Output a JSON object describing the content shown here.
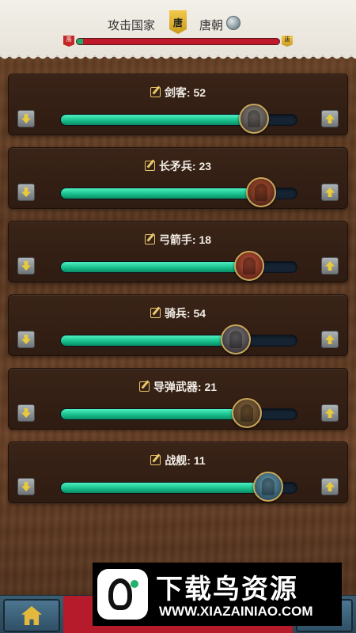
{
  "header": {
    "attack_label": "攻击国家",
    "banner_char": "唐",
    "nation_name": "唐朝",
    "left_flag_char": "燕",
    "right_flag_char": "唐",
    "war_progress": {
      "green": 0.03,
      "red": 0.97
    },
    "colors": {
      "ally": "#1fae6a",
      "enemy": "#c0192b",
      "gold": "#e3b93d"
    }
  },
  "units": [
    {
      "label": "剑客: 52",
      "fill": 0.82,
      "thumb_icon": "swordsman-icon"
    },
    {
      "label": "长矛兵: 23",
      "fill": 0.85,
      "thumb_icon": "spearman-icon"
    },
    {
      "label": "弓箭手: 18",
      "fill": 0.8,
      "thumb_icon": "archer-icon"
    },
    {
      "label": "骑兵: 54",
      "fill": 0.74,
      "thumb_icon": "cavalry-icon"
    },
    {
      "label": "导弹武器: 21",
      "fill": 0.79,
      "thumb_icon": "catapult-icon"
    },
    {
      "label": "战舰: 11",
      "fill": 0.88,
      "thumb_icon": "warship-icon"
    }
  ],
  "bottom_bar": {
    "home_icon": "home-icon"
  },
  "watermark": {
    "title": "下载鸟资源",
    "url": "WWW.XIAZAINIAO.COM"
  }
}
